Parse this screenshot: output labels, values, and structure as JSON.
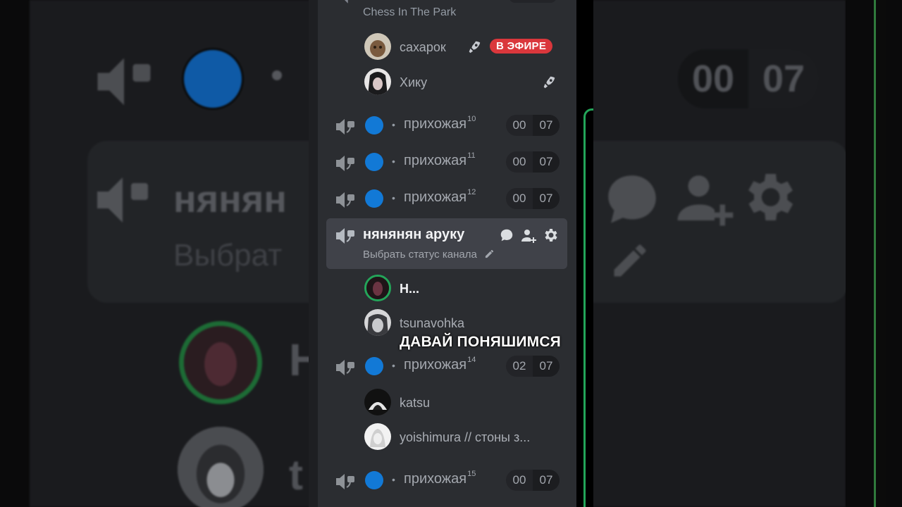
{
  "top_channel": {
    "status": "Chess In The Park"
  },
  "users": [
    {
      "name": "сахарок",
      "live_badge": "В ЭФИРЕ",
      "has_boost": true
    },
    {
      "name": "Хику",
      "has_boost": true
    },
    {
      "name": "Н...",
      "speaking": true
    },
    {
      "name": "tsunavohka"
    },
    {
      "name": "katsu"
    },
    {
      "name": "yoishimura // стоны з..."
    }
  ],
  "voice_channels": [
    {
      "separator": "•",
      "name": "прихожая",
      "sup": "10",
      "count_left": "00",
      "count_right": "07"
    },
    {
      "separator": "•",
      "name": "прихожая",
      "sup": "11",
      "count_left": "00",
      "count_right": "07"
    },
    {
      "separator": "•",
      "name": "прихожая",
      "sup": "12",
      "count_left": "00",
      "count_right": "07"
    },
    {
      "separator": "•",
      "name": "прихожая",
      "sup": "14",
      "count_left": "02",
      "count_right": "07"
    },
    {
      "separator": "•",
      "name": "прихожая",
      "sup": "15",
      "count_left": "00",
      "count_right": "07"
    }
  ],
  "active_channel": {
    "name": "нянянян аруку",
    "status_placeholder": "Выбрать статус канала"
  },
  "caption": "ДАВАЙ ПОНЯШИМСЯ",
  "background": {
    "big_title": "нянян",
    "big_status": "Выбрат",
    "big_user": "Н",
    "big_user2": "t",
    "counter_left": "00",
    "counter_right": "07"
  },
  "colors": {
    "channel_dot": "#1279d6",
    "live_red": "#da373c",
    "speaking_green": "#23a559",
    "sidebar_bg": "#2b2d31",
    "active_bg": "#404249"
  }
}
